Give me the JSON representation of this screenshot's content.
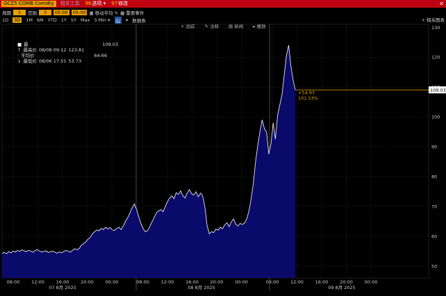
{
  "topbar": {
    "ticker": "GCZ5 COMB Comdty",
    "btn1": "相关工具",
    "btn2_num": "96",
    "btn2": "选项",
    "btn3_num": "97",
    "btn3": "修改",
    "close": "✕"
  },
  "controls": {
    "period_label": "周期",
    "period_value": "1",
    "range_label": "范围",
    "range_value": "3",
    "from": "05:00",
    "to": "05:00",
    "ma_label": "移动平均",
    "events_label": "重要事件"
  },
  "ranges": [
    "1D",
    "3D",
    "1M",
    "6M",
    "YTD",
    "1Y",
    "5Y",
    "Max"
  ],
  "active_range": "3D",
  "interval": "3 Min",
  "chart_type": "山",
  "extra": "数据表",
  "top_right": "+ 相关图表",
  "tools": [
    "追踪",
    "注释",
    "新闻",
    "播放"
  ],
  "legend": {
    "last_label": "最",
    "last_value": "109.03",
    "high_label": "最高价",
    "high_date": "08/08 09:12",
    "high_value": "123.81",
    "avg_label": "平均价",
    "avg_value": "64.66",
    "low_label": "最低价",
    "low_date": "08/06 17:51",
    "low_value": "53.73"
  },
  "annotation": {
    "change": "+54.93",
    "pct": "101.53%"
  },
  "chart_data": {
    "type": "area",
    "series": [
      {
        "values": [
          54.2,
          54.6,
          54.1,
          54.8,
          54.4,
          55.0,
          54.7,
          55.2,
          54.9,
          55.4,
          55.1,
          54.8,
          55.3,
          55.0,
          54.6,
          55.2,
          55.5,
          55.0,
          54.7,
          54.9,
          55.1,
          54.5,
          54.8,
          55.0,
          54.6,
          54.3,
          54.7,
          54.4,
          54.9,
          55.2,
          55.0,
          54.6,
          55.3,
          55.8,
          55.4,
          55.9,
          57.0,
          57.5,
          58.1,
          59.0,
          59.6,
          60.8,
          61.5,
          62.1,
          61.8,
          62.6,
          62.2,
          63.0,
          62.4,
          62.9,
          62.1,
          61.9,
          62.6,
          63.0,
          62.2,
          63.4,
          65.0,
          66.2,
          67.8,
          69.5,
          70.8,
          69.0,
          66.5,
          64.2,
          62.5,
          61.5,
          61.8,
          63.2,
          64.8,
          66.2,
          67.8,
          68.5,
          68.9,
          68.2,
          69.8,
          71.5,
          72.8,
          73.5,
          72.6,
          74.6,
          74.0,
          75.2,
          73.6,
          72.8,
          74.5,
          75.6,
          74.2,
          73.8,
          74.9,
          73.2,
          74.4,
          73.5,
          69.8,
          63.5,
          60.8,
          61.5,
          61.2,
          62.4,
          62.0,
          63.0,
          62.5,
          63.8,
          64.5,
          63.2,
          64.8,
          65.8,
          64.0,
          63.4,
          64.3,
          63.9,
          64.4,
          65.8,
          68.5,
          72.5,
          77.8,
          85.0,
          90.5,
          95.0,
          99.0,
          96.0,
          94.8,
          87.5,
          91.0,
          98.0,
          92.5,
          100.5,
          104.0,
          107.5,
          114.0,
          120.5,
          124.0,
          117.0,
          112.5,
          109.03
        ]
      }
    ],
    "yticks": [
      50,
      60,
      70,
      80,
      90,
      100,
      110,
      120,
      130
    ],
    "ylim": [
      46,
      131
    ],
    "last_value": "109.03",
    "xticks": [
      {
        "label": "08:00",
        "day": 0
      },
      {
        "label": "12:00",
        "day": 0
      },
      {
        "label": "16:00",
        "day": 0
      },
      {
        "label": "20:00",
        "day": 0
      },
      {
        "label": "00:00",
        "day": 0
      },
      {
        "label": "08:00",
        "day": 1
      },
      {
        "label": "12:00",
        "day": 1
      },
      {
        "label": "16:00",
        "day": 1
      },
      {
        "label": "20:00",
        "day": 1
      },
      {
        "label": "00:00",
        "day": 1
      },
      {
        "label": "08:00",
        "day": 2
      },
      {
        "label": "12:00",
        "day": 2
      },
      {
        "label": "16:00",
        "day": 2
      },
      {
        "label": "20:00",
        "day": 2
      },
      {
        "label": "00:00",
        "day": 2
      }
    ],
    "days": [
      "07 8月 2025",
      "08 8月 2025",
      "09 8月 2025"
    ],
    "colors": {
      "fill": "#0a0a6a",
      "line": "#e8e8f0",
      "ref": "#e8a000"
    }
  }
}
